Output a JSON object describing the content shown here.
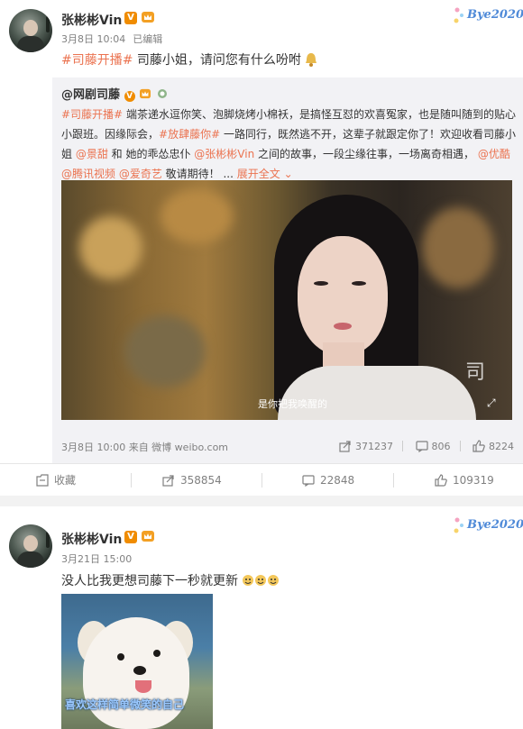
{
  "post1": {
    "username": "张彬彬Vin",
    "verified": "V",
    "time": "3月8日 10:04",
    "edited": "已编辑",
    "sticker": "Bye2020",
    "hashtag": "#司藤开播#",
    "text": " 司藤小姐，请问您有什么吩咐",
    "repost": {
      "author": "@网剧司藤",
      "text_parts": {
        "tag1": "#司藤开播#",
        "t1": " 端茶递水逗你笑、泡脚烧烤小棉袄，是搞怪互怼的欢喜冤家，也是随叫随到的贴心小跟班。因缘际会，",
        "tag2": "#放肆藤你#",
        "t2": " 一路同行，既然逃不开，这辈子就跟定你了！欢迎收看司藤小姐 ",
        "at1": "@景甜",
        "t3": " 和 她的乖怂忠仆 ",
        "at2": "@张彬彬Vin",
        "t4": " 之间的故事，一段尘缘往事，一场离奇相遇，",
        "at3": "@优酷",
        "at4": "@腾讯视频",
        "at5": "@爱奇艺",
        "t5": " 敬请期待！ ... ",
        "expand": "展开全文 ⌄"
      },
      "video_subtitle": "是你把我唤醒的",
      "video_watermark": "司",
      "footer_time": "3月8日 10:00 来自 微博 weibo.com",
      "forwards": "371237",
      "comments": "806",
      "likes": "8224"
    },
    "actions": {
      "collect": "收藏",
      "forward": "358854",
      "comment": "22848",
      "like": "109319"
    }
  },
  "post2": {
    "username": "张彬彬Vin",
    "verified": "V",
    "time": "3月21日 15:00",
    "sticker": "Bye2020",
    "text": "没人比我更想司藤下一秒就更新",
    "image_caption": "喜欢这样简单微笑的自己"
  },
  "colors": {
    "link": "#eb7350",
    "meta": "#808080",
    "badge": "#f08c00",
    "sticker": "#4f8ad8"
  },
  "icons": [
    "crown-icon",
    "verified-icon",
    "collect-icon",
    "forward-icon",
    "comment-icon",
    "like-icon",
    "fullscreen-icon",
    "dog-emoji-icon"
  ]
}
